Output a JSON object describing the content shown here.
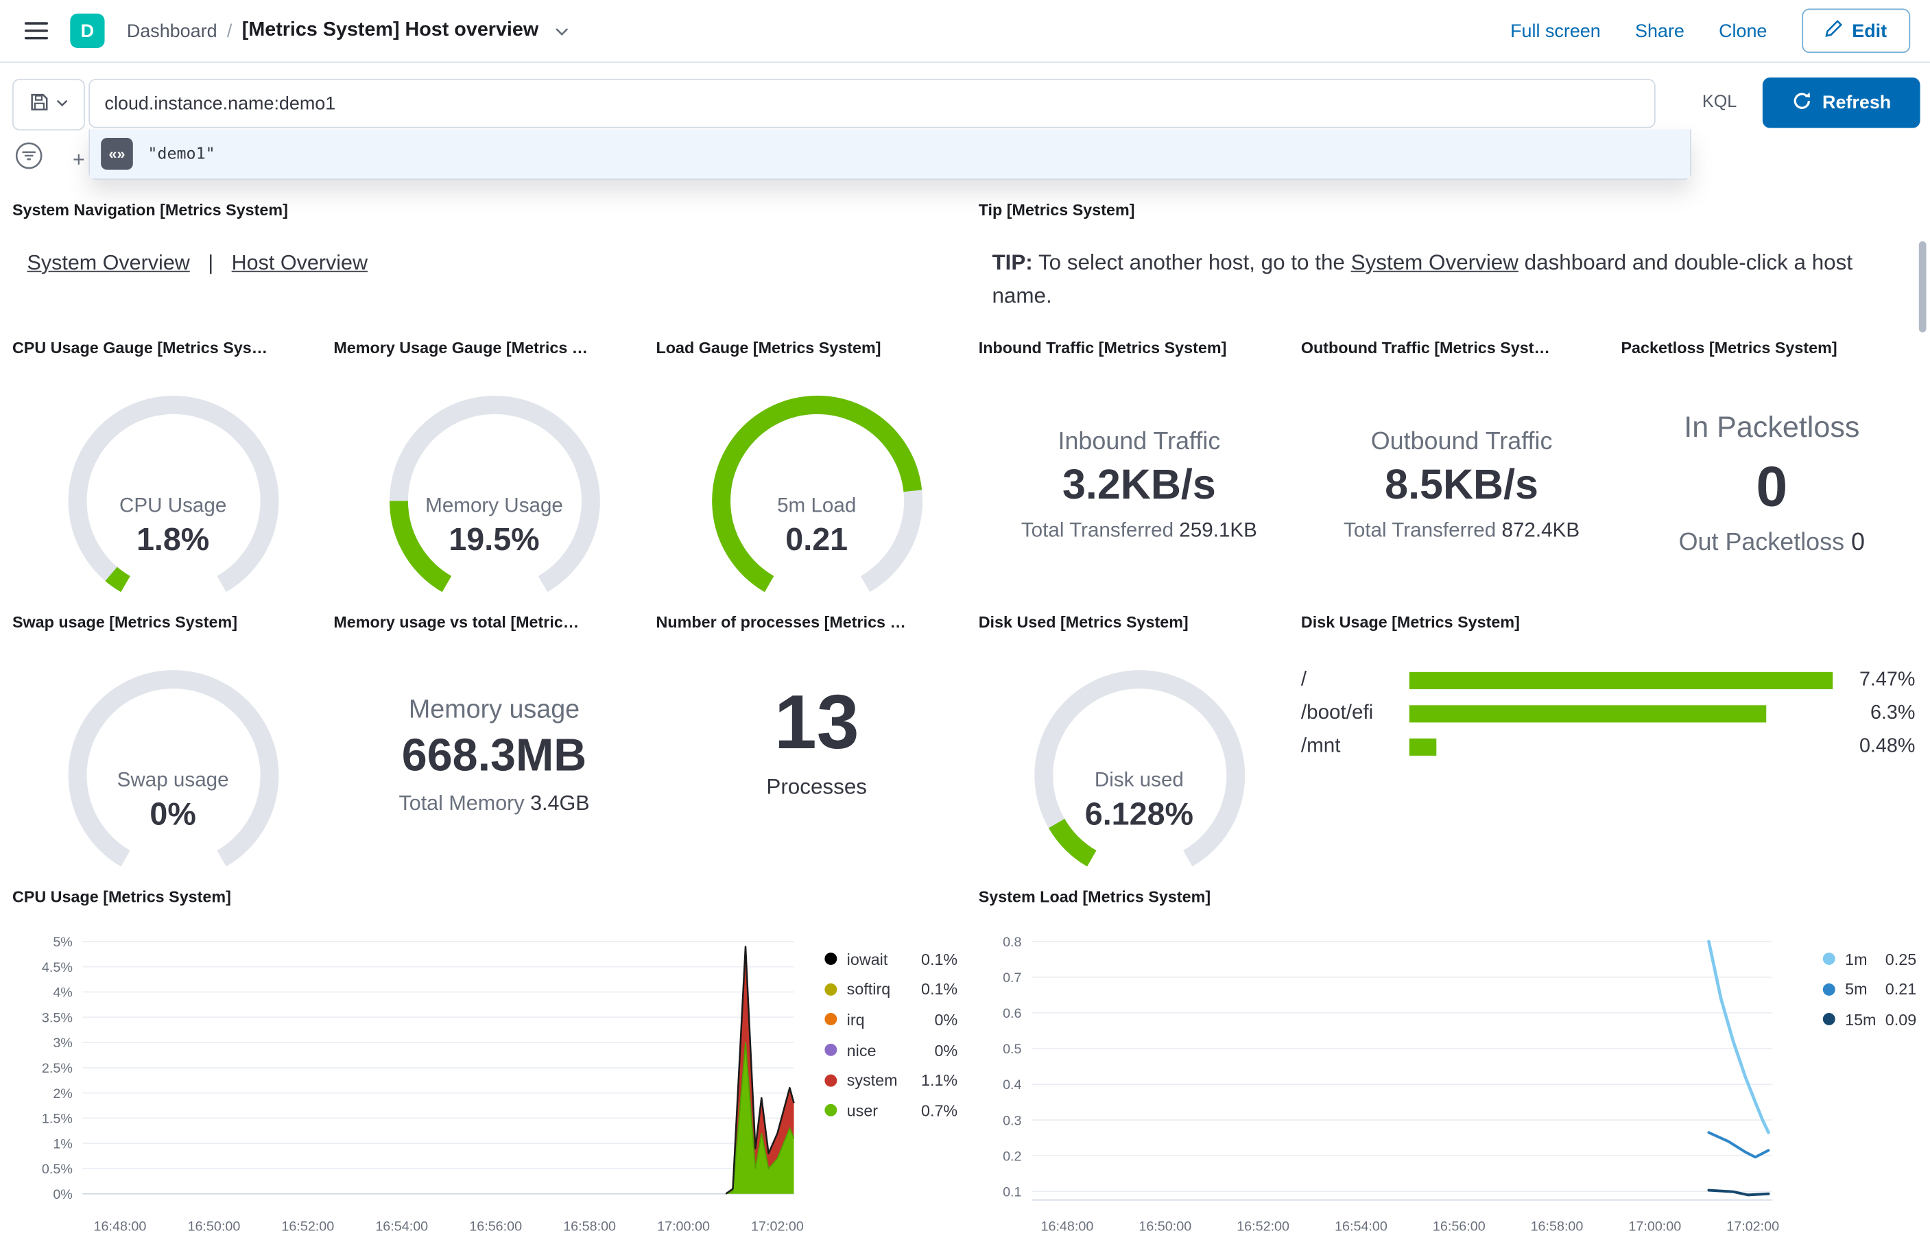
{
  "theme": {
    "primary": "#006BB4",
    "green": "#68BC00",
    "teal": "#00BFB3",
    "gauge_track": "#E1E5EB"
  },
  "chrome": {
    "space_initial": "D",
    "breadcrumb": "Dashboard",
    "separator": "/",
    "title": "[Metrics System] Host overview",
    "full_screen": "Full screen",
    "share": "Share",
    "clone": "Clone",
    "edit": "Edit"
  },
  "query_bar": {
    "query": "cloud.instance.name:demo1",
    "language": "KQL",
    "refresh": "Refresh",
    "suggestion": "\"demo1\""
  },
  "panels": {
    "system_navigation": {
      "title": "System Navigation [Metrics System]",
      "link1": "System Overview",
      "separator": "|",
      "link2": "Host Overview"
    },
    "tip": {
      "title": "Tip [Metrics System]",
      "bold": "TIP:",
      "before": " To select another host, go to the ",
      "link": "System Overview",
      "after": " dashboard and double-click a host name."
    },
    "cpu_gauge": {
      "title": "CPU Usage Gauge [Metrics Sys…",
      "label": "CPU Usage",
      "value": "1.8%",
      "fraction": 0.035
    },
    "memory_gauge": {
      "title": "Memory Usage Gauge [Metrics …",
      "label": "Memory Usage",
      "value": "19.5%",
      "fraction": 0.2
    },
    "load_gauge": {
      "title": "Load Gauge [Metrics System]",
      "label": "5m Load",
      "value": "0.21",
      "fraction": 0.78
    },
    "inbound": {
      "title": "Inbound Traffic [Metrics System]",
      "label": "Inbound Traffic",
      "value": "3.2KB/s",
      "sub_label": "Total Transferred",
      "sub_value": "259.1KB"
    },
    "outbound": {
      "title": "Outbound Traffic [Metrics Syst…",
      "label": "Outbound Traffic",
      "value": "8.5KB/s",
      "sub_label": "Total Transferred",
      "sub_value": "872.4KB"
    },
    "packetloss": {
      "title": "Packetloss [Metrics System]",
      "label": "In Packetloss",
      "value": "0",
      "sub_label": "Out Packetloss",
      "sub_value": "0"
    },
    "swap_gauge": {
      "title": "Swap usage [Metrics System]",
      "label": "Swap usage",
      "value": "0%",
      "fraction": 0
    },
    "memory_total": {
      "title": "Memory usage vs total [Metric…",
      "label": "Memory usage",
      "value": "668.3MB",
      "sub_label": "Total Memory",
      "sub_value": "3.4GB"
    },
    "processes": {
      "title": "Number of processes [Metrics …",
      "value": "13",
      "label": "Processes"
    },
    "disk_used_gauge": {
      "title": "Disk Used [Metrics System]",
      "label": "Disk used",
      "value": "6.128%",
      "fraction": 0.1
    },
    "disk_usage": {
      "title": "Disk Usage [Metrics System]"
    },
    "cpu_chart": {
      "title": "CPU Usage [Metrics System]"
    },
    "load_chart": {
      "title": "System Load [Metrics System]"
    }
  },
  "chart_data": {
    "disk_usage": {
      "type": "bar",
      "orientation": "horizontal",
      "categories": [
        "/",
        "/boot/efi",
        "/mnt"
      ],
      "values": [
        7.47,
        6.3,
        0.48
      ],
      "value_labels": [
        "7.47%",
        "6.3%",
        "0.48%"
      ],
      "max": 7.47
    },
    "cpu_usage": {
      "type": "area",
      "stacked": true,
      "title": "CPU Usage [Metrics System]",
      "x_domain": [
        -0.8,
        14.35
      ],
      "y_domain": [
        0,
        5
      ],
      "yticks": [
        [
          5,
          "5%"
        ],
        [
          4.5,
          "4.5%"
        ],
        [
          4,
          "4%"
        ],
        [
          3.5,
          "3.5%"
        ],
        [
          3,
          "3%"
        ],
        [
          2.5,
          "2.5%"
        ],
        [
          2,
          "2%"
        ],
        [
          1.5,
          "1.5%"
        ],
        [
          1,
          "1%"
        ],
        [
          0.5,
          "0.5%"
        ],
        [
          0,
          "0%"
        ]
      ],
      "xticks": [
        [
          0,
          "16:48:00"
        ],
        [
          2,
          "16:50:00"
        ],
        [
          4,
          "16:52:00"
        ],
        [
          6,
          "16:54:00"
        ],
        [
          8,
          "16:56:00"
        ],
        [
          10,
          "16:58:00"
        ],
        [
          12,
          "17:00:00"
        ],
        [
          14,
          "17:02:00"
        ]
      ],
      "t": [
        -0.8,
        12.9,
        13.05,
        13.32,
        13.53,
        13.66,
        13.81,
        14.0,
        14.26,
        14.35
      ],
      "user": [
        0,
        0,
        0.05,
        3.0,
        0.5,
        1.2,
        0.5,
        0.7,
        1.3,
        1.1
      ],
      "system": [
        0,
        0,
        0.05,
        1.9,
        0.4,
        0.7,
        0.3,
        0.5,
        0.8,
        0.7
      ],
      "colors": {
        "user": "#68BC00",
        "user_stroke": "#53A000",
        "system": "#C6352B",
        "total_line": "#1b1b1b"
      },
      "legend": [
        {
          "name": "iowait",
          "value": "0.1%",
          "color": "#000000"
        },
        {
          "name": "softirq",
          "value": "0.1%",
          "color": "#B4A800"
        },
        {
          "name": "irq",
          "value": "0%",
          "color": "#E8740C"
        },
        {
          "name": "nice",
          "value": "0%",
          "color": "#8B6BC7"
        },
        {
          "name": "system",
          "value": "1.1%",
          "color": "#C6352B"
        },
        {
          "name": "user",
          "value": "0.7%",
          "color": "#68BC00"
        }
      ]
    },
    "system_load": {
      "type": "line",
      "title": "System Load [Metrics System]",
      "x_domain": [
        -0.73,
        14.4
      ],
      "y_domain": [
        0.1,
        0.8
      ],
      "yticks": [
        [
          0.8,
          "0.8"
        ],
        [
          0.7,
          "0.7"
        ],
        [
          0.6,
          "0.6"
        ],
        [
          0.5,
          "0.5"
        ],
        [
          0.4,
          "0.4"
        ],
        [
          0.3,
          "0.3"
        ],
        [
          0.2,
          "0.2"
        ],
        [
          0.1,
          "0.1"
        ]
      ],
      "xticks": [
        [
          0,
          "16:48:00"
        ],
        [
          2,
          "16:50:00"
        ],
        [
          4,
          "16:52:00"
        ],
        [
          6,
          "16:54:00"
        ],
        [
          8,
          "16:56:00"
        ],
        [
          10,
          "16:58:00"
        ],
        [
          12,
          "17:00:00"
        ],
        [
          14,
          "17:02:00"
        ]
      ],
      "series": [
        {
          "name": "1m",
          "value": "0.25",
          "color": "#7FC9F0",
          "width": 2.6,
          "points": [
            [
              13.1,
              0.8
            ],
            [
              13.35,
              0.64
            ],
            [
              13.6,
              0.52
            ],
            [
              13.85,
              0.42
            ],
            [
              14.05,
              0.35
            ],
            [
              14.2,
              0.3
            ],
            [
              14.32,
              0.265
            ]
          ]
        },
        {
          "name": "5m",
          "value": "0.21",
          "color": "#2E86C8",
          "width": 2.2,
          "points": [
            [
              13.1,
              0.265
            ],
            [
              13.5,
              0.24
            ],
            [
              13.85,
              0.21
            ],
            [
              14.05,
              0.196
            ],
            [
              14.32,
              0.215
            ]
          ]
        },
        {
          "name": "15m",
          "value": "0.09",
          "color": "#16486F",
          "width": 2.2,
          "points": [
            [
              13.1,
              0.103
            ],
            [
              13.6,
              0.099
            ],
            [
              13.9,
              0.09
            ],
            [
              14.32,
              0.093
            ]
          ]
        }
      ]
    }
  }
}
